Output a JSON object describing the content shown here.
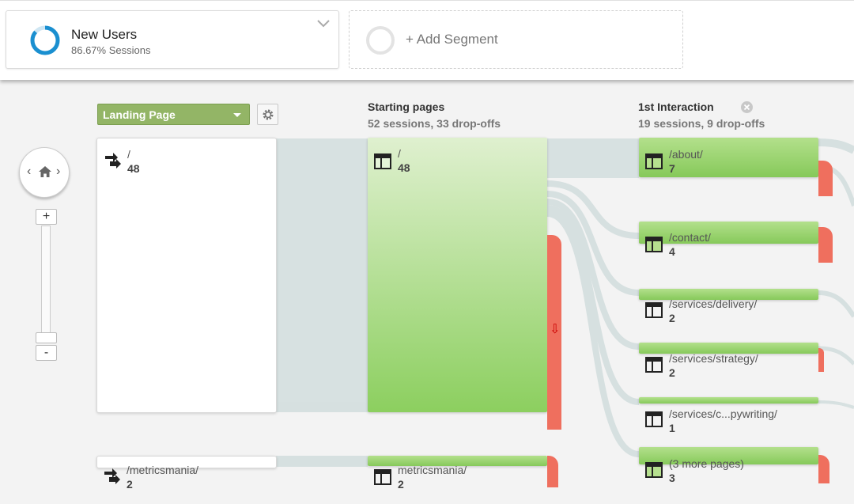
{
  "segments": {
    "active": {
      "name": "New Users",
      "sub": "86.67% Sessions",
      "color": "#2d9cdb"
    },
    "add": {
      "label": "+ Add Segment"
    }
  },
  "dimension": {
    "label": "Landing Page"
  },
  "columns": {
    "starting": {
      "title": "Starting pages",
      "sub": "52 sessions, 33 drop-offs"
    },
    "interaction": {
      "title": "1st Interaction",
      "sub": "19 sessions, 9 drop-offs"
    }
  },
  "landing_nodes": [
    {
      "label": "/",
      "count": "48"
    },
    {
      "label": "/metricsmania/",
      "count": "2"
    }
  ],
  "starting_nodes": [
    {
      "label": "/",
      "count": "48"
    },
    {
      "label": "metricsmania/",
      "count": "2"
    }
  ],
  "interaction_nodes": [
    {
      "label": "/about/",
      "count": "7"
    },
    {
      "label": "/contact/",
      "count": "4"
    },
    {
      "label": "/services/delivery/",
      "count": "2"
    },
    {
      "label": "/services/strategy/",
      "count": "2"
    },
    {
      "label": "/services/c...pywriting/",
      "count": "1"
    },
    {
      "label": "(3 more pages)",
      "count": "3"
    }
  ],
  "zoom": {
    "plus": "+",
    "minus": "-"
  },
  "colors": {
    "node_green": "#8ccf5f",
    "dropoff_red": "#ef6f5e",
    "link_gray": "#d5dfdf"
  }
}
